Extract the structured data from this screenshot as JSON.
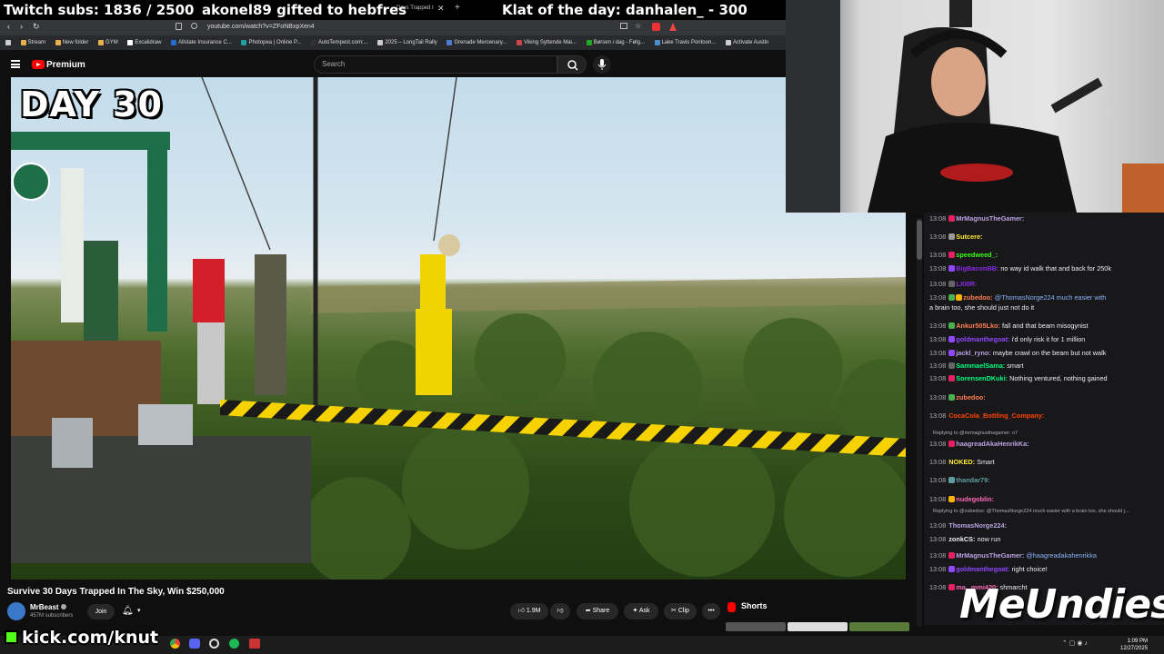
{
  "overlay": {
    "subs": "Twitch subs: 1836 / 2500",
    "gift": "akonel89 gifted to hebfres",
    "klat": "Klat of the day: danhalen_ - 300"
  },
  "browser": {
    "tab_title": "Days Trapped I",
    "url": "youtube.com/watch?v=ZFoNBxpXen4",
    "bookmarks": [
      "Stream",
      "New folder",
      "GYM",
      "Excalidraw",
      "Allstate Insurance C...",
      "Photopea | Online P...",
      "AutoTempest.com:...",
      "2025 – LongTail Rally",
      "Grenade Mercenary...",
      "Viking Syttende Mai...",
      "Børsen i dag - Følg...",
      "Lake Travis Pontoon...",
      "Activate Austin"
    ]
  },
  "youtube": {
    "logo": "Premium",
    "search_placeholder": "Search",
    "overlay_text": "DAY 30",
    "video_title": "Survive 30 Days Trapped In The Sky, Win $250,000",
    "channel": "MrBeast",
    "subscribers": "457M subscribers",
    "join": "Join",
    "likes": "1.9M",
    "share": "Share",
    "ask": "Ask",
    "clip": "Clip",
    "more": "•••",
    "shorts": "Shorts"
  },
  "chat": {
    "messages": [
      {
        "time": "13:08",
        "name": "MrMagnusTheGamer:",
        "color": "#b9a3e3",
        "text": ""
      },
      {
        "time": "13:08",
        "name": "Sutcere:",
        "color": "#ffeb3b",
        "text": ""
      },
      {
        "time": "13:08",
        "name": "speedweed_:",
        "color": "#39ff14",
        "text": ""
      },
      {
        "time": "13:08",
        "name": "BigBaconBB:",
        "color": "#8a2be2",
        "text": "no way id walk that and back for 250k"
      },
      {
        "time": "13:08",
        "name": "LXIIIR:",
        "color": "#8a2be2",
        "text": ""
      },
      {
        "time": "13:08",
        "name": "zubedoo:",
        "color": "#ff7f50",
        "text": "@ThomasNorge224 much easier with"
      },
      {
        "time": "",
        "name": "",
        "color": "#efeff1",
        "text": "a brain too, she should just not do it"
      },
      {
        "time": "13:08",
        "name": "Ankur505Lko:",
        "color": "#ff7f50",
        "text": "fall and        that beam misogynist"
      },
      {
        "time": "13:08",
        "name": "goldmanthegoat:",
        "color": "#9147ff",
        "text": "i'd only risk it for 1 million"
      },
      {
        "time": "13:08",
        "name": "jackl_ryno:",
        "color": "#b9a3e3",
        "text": "maybe crawl on the beam but not walk"
      },
      {
        "time": "13:08",
        "name": "SammaelSama:",
        "color": "#00ff7f",
        "text": "smart"
      },
      {
        "time": "13:08",
        "name": "SorensenDKuki:",
        "color": "#00ff7f",
        "text": "Nothing ventured, nothing gained"
      },
      {
        "time": "13:08",
        "name": "zubedoo:",
        "color": "#ff7f50",
        "text": ""
      },
      {
        "time": "13:08",
        "name": "CocaCola_Bottling_Company:",
        "color": "#ff4500",
        "text": ""
      },
      {
        "time": "13:08",
        "name": "haagreadAkaHenrikKa:",
        "color": "#b9a3e3",
        "text": ""
      },
      {
        "time": "13:08",
        "name": "NOKED:",
        "color": "#ffeb3b",
        "text": "Smart"
      },
      {
        "time": "13:08",
        "name": "thandar79:",
        "color": "#5f9ea0",
        "text": ""
      },
      {
        "time": "13:08",
        "name": "nudegoblin:",
        "color": "#ff69b4",
        "text": ""
      },
      {
        "time": "13:08",
        "name": "ThomasNorge224:",
        "color": "#b9a3e3",
        "text": ""
      },
      {
        "time": "13:08",
        "name": "zonkCS:",
        "color": "#efeff1",
        "text": "now run"
      },
      {
        "time": "13:08",
        "name": "MrMagnusTheGamer:",
        "color": "#b9a3e3",
        "text": "@haagreadakahenrikka"
      },
      {
        "time": "13:08",
        "name": "goldmanthegoat:",
        "color": "#9147ff",
        "text": "right choice!"
      },
      {
        "time": "13:08",
        "name": "ma...mmi420:",
        "color": "#ff69b4",
        "text": "shmarcht"
      }
    ],
    "replies": [
      "Replying to @mrmagnusthegamer: o7",
      "Replying to @zubedoo: @ThomasNorge224 much easier with a brain too, she should j..."
    ]
  },
  "sponsor": "MeUndies",
  "kick": "kick.com/knut",
  "clock": {
    "time": "1:09 PM",
    "date": "12/27/2025"
  }
}
